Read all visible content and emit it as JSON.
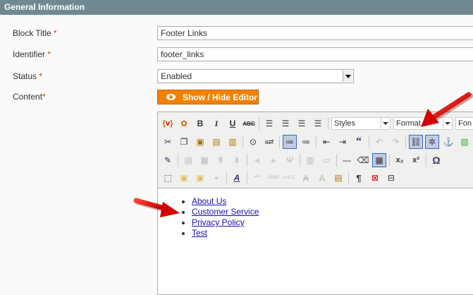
{
  "section": {
    "title": "General Information"
  },
  "form": {
    "block_title": {
      "label": "Block Title",
      "required": "*",
      "value": "Footer Links"
    },
    "identifier": {
      "label": "Identifier",
      "required": "*",
      "value": "footer_links"
    },
    "status": {
      "label": "Status",
      "required": "*",
      "value": "Enabled"
    },
    "content": {
      "label": "Content",
      "required": "*"
    },
    "toggle_editor": "Show / Hide Editor"
  },
  "toolbar": {
    "styles": "Styles",
    "format": "Format",
    "font": "Fon"
  },
  "content_links": [
    "About Us",
    "Customer Service",
    "Privacy Policy",
    "Test"
  ],
  "colors": {
    "accent": "#f18200",
    "arrow": "#e3000b",
    "header": "#6f8992"
  }
}
